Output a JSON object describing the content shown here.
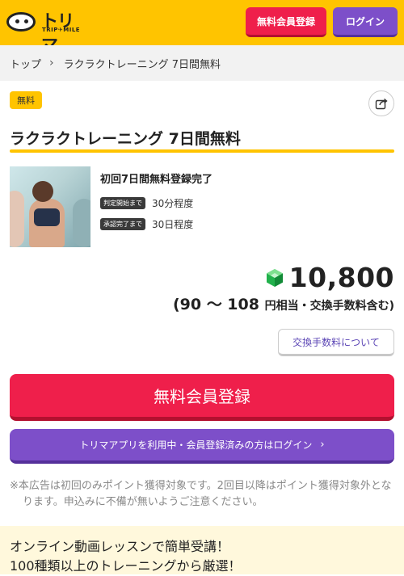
{
  "header": {
    "logo_text": "トリマ",
    "logo_sub": "TRIP✈MILE",
    "register_label": "無料会員登録",
    "login_label": "ログイン"
  },
  "breadcrumb": {
    "home": "トップ",
    "current": "ラクラクトレーニング 7日間無料"
  },
  "offer": {
    "badge": "無料",
    "title": "ラクラクトレーニング 7日間無料",
    "condition": "初回7日間無料登録完了",
    "judge_tag": "判定開始まで",
    "judge_value": "30分程度",
    "approve_tag": "承認完了まで",
    "approve_value": "30日程度",
    "points": "10,800",
    "equiv_prefix": "(90 〜 108",
    "equiv_suffix": "円相当・交換手数料含む)",
    "fee_link": "交換手数料について"
  },
  "actions": {
    "register_cta": "無料会員登録",
    "app_login": "トリマアプリを利用中・会員登録済みの方はログイン"
  },
  "note": "※本広告は初回のみポイント獲得対象です。2回目以降はポイント獲得対象外となります。申込みに不備が無いようご注意ください。",
  "description": {
    "line1": "オンライン動画レッスンで簡単受講！",
    "line2": "100種類以上のトレーニングから厳選！"
  },
  "colors": {
    "brand_yellow": "#ffc400",
    "register_red": "#ef1f4b",
    "login_purple": "#7d4fc9"
  }
}
